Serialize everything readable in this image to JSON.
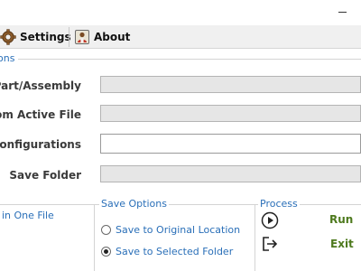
{
  "toolbar": {
    "settings_label": "Settings",
    "about_label": "About"
  },
  "options": {
    "section_title": "ons",
    "rows": [
      {
        "label": "t Part/Assembly",
        "value": ""
      },
      {
        "label": "from Active File",
        "value": ""
      },
      {
        "label": "d Configurations",
        "value": ""
      },
      {
        "label": "Save Folder",
        "value": ""
      }
    ]
  },
  "left_group": {
    "option_text": "in One File"
  },
  "save_options": {
    "title": "Save Options",
    "choices": [
      {
        "label": "Save to Original Location",
        "checked": false
      },
      {
        "label": "Save to Selected Folder",
        "checked": true
      }
    ]
  },
  "process": {
    "title": "Process",
    "run_label": "Run",
    "exit_label": "Exit"
  },
  "colors": {
    "accent_blue": "#2a6fb8",
    "process_green": "#4e7a1e",
    "toolbar_bg": "#f0f0f0"
  },
  "icons": {
    "settings": "gear-icon",
    "about": "about-person-icon",
    "run": "play-circle-icon",
    "exit": "exit-arrow-icon",
    "minimize": "minimize-icon"
  }
}
